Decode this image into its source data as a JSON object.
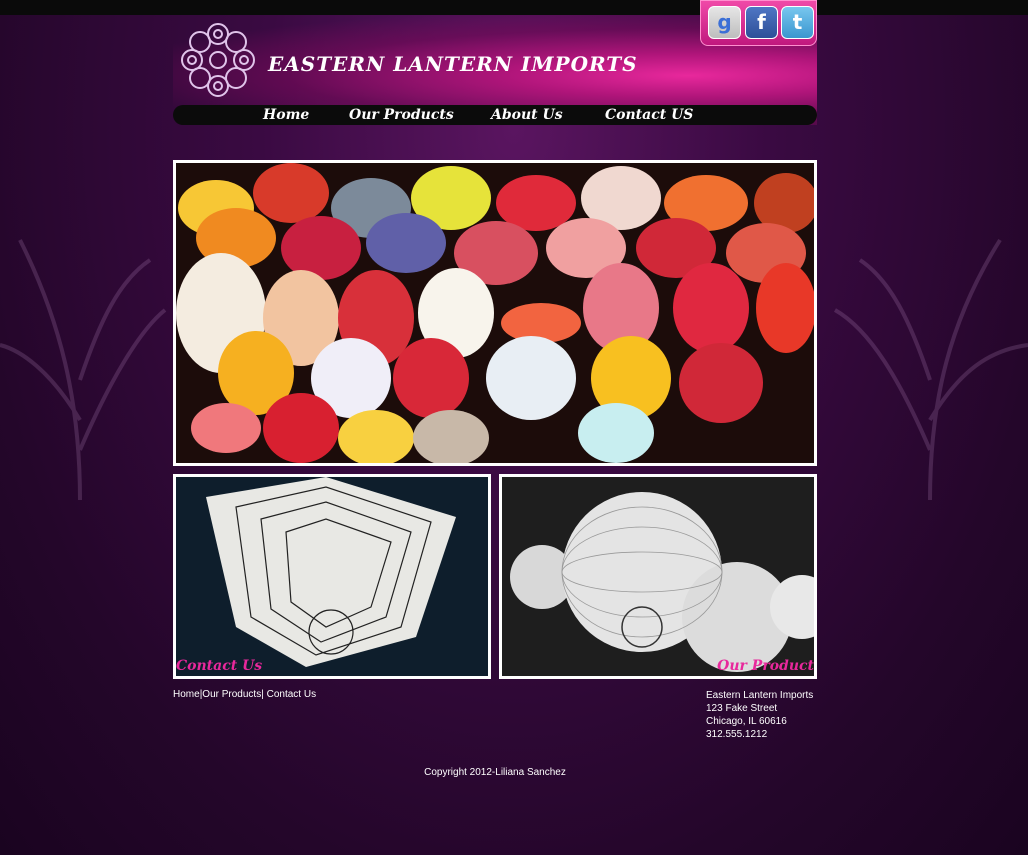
{
  "site": {
    "title": "EASTERN LANTERN IMPORTS"
  },
  "social": [
    {
      "name": "google-plus-icon",
      "glyph": "g"
    },
    {
      "name": "facebook-icon",
      "glyph": "f"
    },
    {
      "name": "twitter-icon",
      "glyph": "t"
    }
  ],
  "nav": {
    "items": [
      {
        "label": "Home"
      },
      {
        "label": "Our Products"
      },
      {
        "label": "About Us"
      },
      {
        "label": "Contact US"
      }
    ]
  },
  "tiles": {
    "left_label": "Contact Us",
    "right_label": "Our Product"
  },
  "footer": {
    "links": [
      "Home",
      "Our Products",
      " Contact Us"
    ],
    "separator": "|",
    "address": {
      "name": "Eastern Lantern Imports",
      "street": "123 Fake Street",
      "city": "Chicago, IL 60616",
      "phone": "312.555.1212"
    },
    "copyright": "Copyright 2012-Liliana Sanchez"
  },
  "colors": {
    "accent": "#e8289c",
    "background": "#2a0530",
    "nav_bar": "#0b0b0b"
  }
}
